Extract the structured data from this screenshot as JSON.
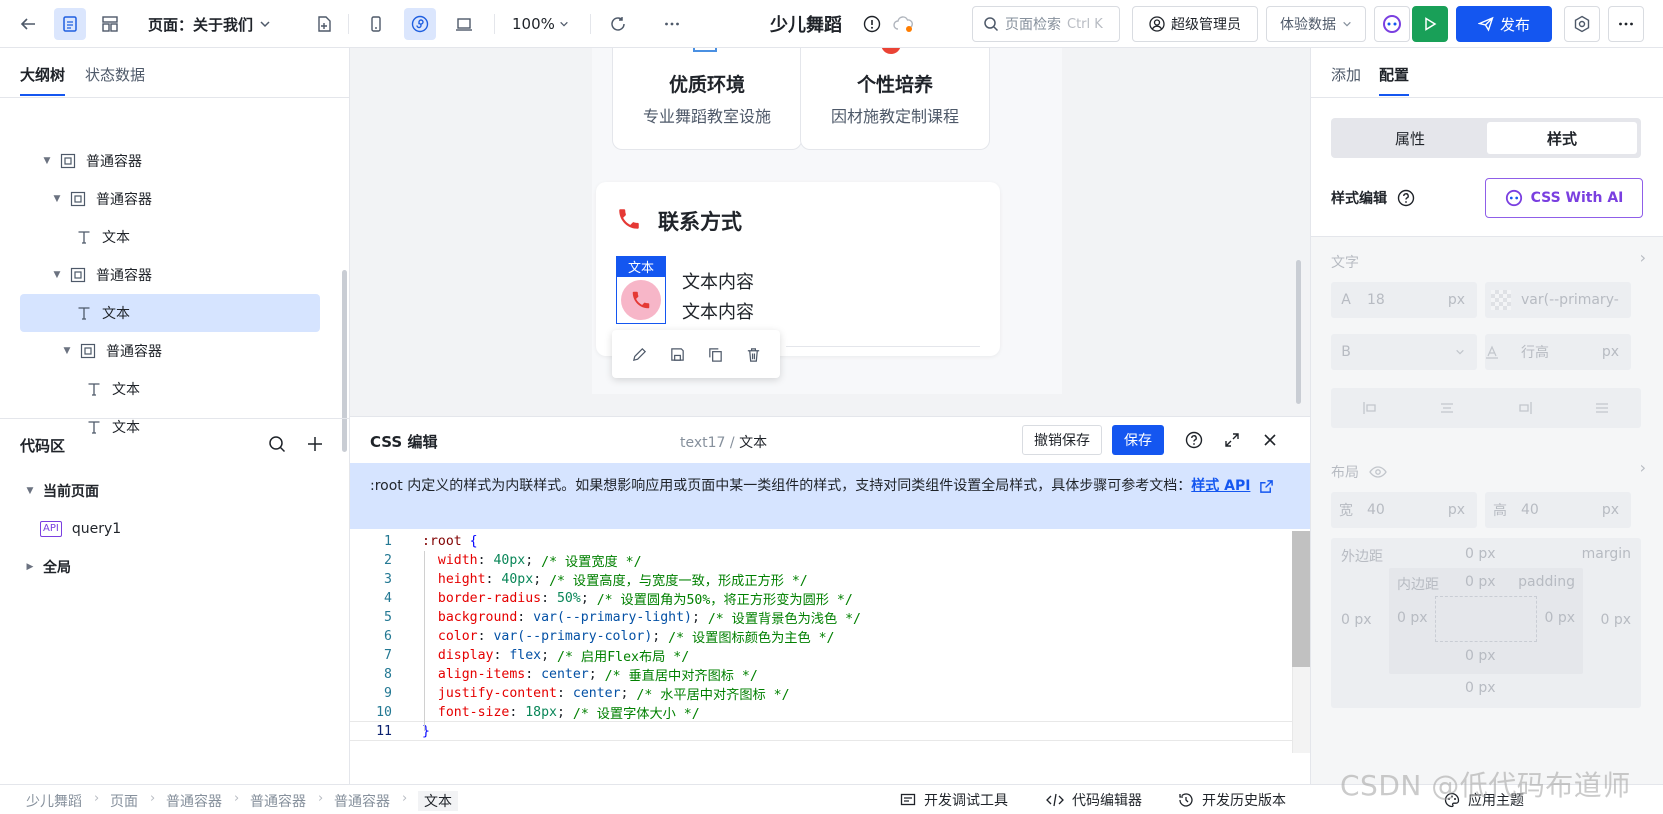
{
  "topbar": {
    "page_label": "页面：关于我们",
    "zoom": "100%",
    "app_title": "少儿舞蹈",
    "search_placeholder": "页面检索",
    "search_shortcut": "Ctrl K",
    "user_label": "超级管理员",
    "data_label": "体验数据",
    "publish_label": "发布"
  },
  "left": {
    "tabs": [
      "大纲树",
      "状态数据"
    ],
    "tree": [
      {
        "label": "普通容器",
        "type": "container",
        "depth": 0,
        "expanded": true
      },
      {
        "label": "普通容器",
        "type": "container",
        "depth": 1,
        "expanded": true
      },
      {
        "label": "文本",
        "type": "text",
        "depth": 2
      },
      {
        "label": "普通容器",
        "type": "container",
        "depth": 1,
        "expanded": true
      },
      {
        "label": "文本",
        "type": "text",
        "depth": 2,
        "selected": true
      },
      {
        "label": "普通容器",
        "type": "container",
        "depth": 2,
        "expanded": true
      },
      {
        "label": "文本",
        "type": "text",
        "depth": 3
      },
      {
        "label": "文本",
        "type": "text",
        "depth": 3
      }
    ],
    "code_title": "代码区",
    "current_page": "当前页面",
    "query_badge": "API",
    "query_name": "query1",
    "global_label": "全局"
  },
  "canvas": {
    "features": [
      {
        "title": "优质环境",
        "desc": "专业舞蹈教室设施"
      },
      {
        "title": "个性培养",
        "desc": "因材施教定制课程"
      }
    ],
    "contact_title": "联系方式",
    "selected_tag": "文本",
    "contact_lines": [
      "文本内容",
      "文本内容"
    ]
  },
  "editor": {
    "title": "CSS 编辑",
    "breadcrumb_parent": "text17",
    "breadcrumb_sep": " / ",
    "breadcrumb_current": "文本",
    "undo_label": "撤销保存",
    "save_label": "保存",
    "notice": ":root 内定义的样式为内联样式。如果想影响应用或页面中某一类组件的样式，支持对同类组件设置全局样式，具体步骤可参考文档：",
    "notice_link": "样式 API",
    "code": [
      {
        "n": "1",
        "parts": [
          [
            "sel",
            ":root "
          ],
          [
            "brace",
            "{"
          ]
        ]
      },
      {
        "n": "2",
        "parts": [
          [
            "prop",
            "  width"
          ],
          [
            "pun",
            ": "
          ],
          [
            "num",
            "40px"
          ],
          [
            "pun",
            "; "
          ],
          [
            "cm",
            "/* 设置宽度 */"
          ]
        ]
      },
      {
        "n": "3",
        "parts": [
          [
            "prop",
            "  height"
          ],
          [
            "pun",
            ": "
          ],
          [
            "num",
            "40px"
          ],
          [
            "pun",
            "; "
          ],
          [
            "cm",
            "/* 设置高度，与宽度一致，形成正方形 */"
          ]
        ]
      },
      {
        "n": "4",
        "parts": [
          [
            "prop",
            "  border-radius"
          ],
          [
            "pun",
            ": "
          ],
          [
            "num",
            "50%"
          ],
          [
            "pun",
            "; "
          ],
          [
            "cm",
            "/* 设置圆角为50%，将正方形变为圆形 */"
          ]
        ]
      },
      {
        "n": "5",
        "parts": [
          [
            "prop",
            "  background"
          ],
          [
            "pun",
            ": "
          ],
          [
            "val",
            "var(--primary-light)"
          ],
          [
            "pun",
            "; "
          ],
          [
            "cm",
            "/* 设置背景色为浅色 */"
          ]
        ]
      },
      {
        "n": "6",
        "parts": [
          [
            "prop",
            "  color"
          ],
          [
            "pun",
            ": "
          ],
          [
            "val",
            "var(--primary-color)"
          ],
          [
            "pun",
            "; "
          ],
          [
            "cm",
            "/* 设置图标颜色为主色 */"
          ]
        ]
      },
      {
        "n": "7",
        "parts": [
          [
            "prop",
            "  display"
          ],
          [
            "pun",
            ": "
          ],
          [
            "val",
            "flex"
          ],
          [
            "pun",
            "; "
          ],
          [
            "cm",
            "/* 启用Flex布局 */"
          ]
        ]
      },
      {
        "n": "8",
        "parts": [
          [
            "prop",
            "  align-items"
          ],
          [
            "pun",
            ": "
          ],
          [
            "val",
            "center"
          ],
          [
            "pun",
            "; "
          ],
          [
            "cm",
            "/* 垂直居中对齐图标 */"
          ]
        ]
      },
      {
        "n": "9",
        "parts": [
          [
            "prop",
            "  justify-content"
          ],
          [
            "pun",
            ": "
          ],
          [
            "val",
            "center"
          ],
          [
            "pun",
            "; "
          ],
          [
            "cm",
            "/* 水平居中对齐图标 */"
          ]
        ]
      },
      {
        "n": "10",
        "parts": [
          [
            "prop",
            "  font-size"
          ],
          [
            "pun",
            ": "
          ],
          [
            "num",
            "18px"
          ],
          [
            "pun",
            "; "
          ],
          [
            "cm",
            "/* 设置字体大小 */"
          ]
        ]
      },
      {
        "n": "11",
        "parts": [
          [
            "brace",
            "}"
          ]
        ]
      }
    ]
  },
  "right": {
    "tabs": [
      "添加",
      "配置"
    ],
    "segments": [
      "属性",
      "样式"
    ],
    "style_edit_label": "样式编辑",
    "css_ai_label": "CSS With AI",
    "text_section": "文字",
    "font_size_prefix": "A",
    "font_size": "18",
    "unit_px": "px",
    "font_color": "var(--primary-",
    "bold_prefix": "B",
    "line_height_placeholder": "行高",
    "layout_section": "布局",
    "width_label": "宽",
    "width_value": "40",
    "height_label": "高",
    "height_value": "40",
    "margin_label": "外边距",
    "margin_en": "margin",
    "padding_label": "内边距",
    "padding_en": "padding",
    "box_value": "0 px"
  },
  "bottom": {
    "breadcrumbs": [
      "少儿舞蹈",
      "页面",
      "普通容器",
      "普通容器",
      "普通容器",
      "文本"
    ],
    "dev_tools": "开发调试工具",
    "code_editor": "代码编辑器",
    "history": "开发历史版本",
    "theme": "应用主题"
  },
  "watermark": "CSDN @低代码布道师",
  "colors": {
    "primary": "#1456f0",
    "selected_bg": "#d6e4ff",
    "run_green": "#19a058",
    "ai_purple": "#7a3fe0",
    "phone_red": "#e53935",
    "phone_circle": "#f7b6c8"
  }
}
